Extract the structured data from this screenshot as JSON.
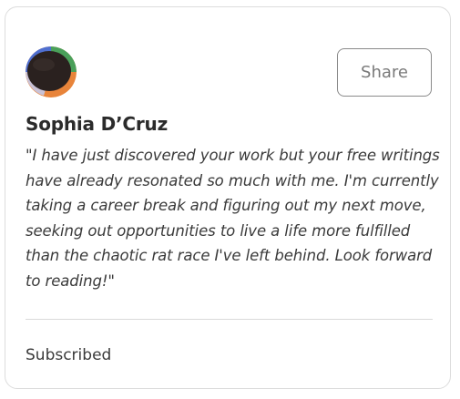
{
  "testimonial": {
    "avatar_icon": "user-avatar-icon",
    "share_label": "Share",
    "name": "Sophia D’Cruz",
    "quote": "\"I have just discovered your work but your free writings have already resonated so much with me. I'm currently taking a career break and figuring out my next move, seeking out opportunities to live a life more fulfilled than the chaotic rat race I've left behind. Look forward to reading!\"",
    "status": "Subscribed"
  },
  "colors": {
    "border": "#dcdcdc",
    "text": "#3a3a3a",
    "button_border": "#8a8a8a",
    "avatar_ring_orange": "#e8843a",
    "avatar_ring_green": "#4aa05a",
    "avatar_ring_blue": "#4f6fd0",
    "avatar_center": "#2a211f"
  }
}
